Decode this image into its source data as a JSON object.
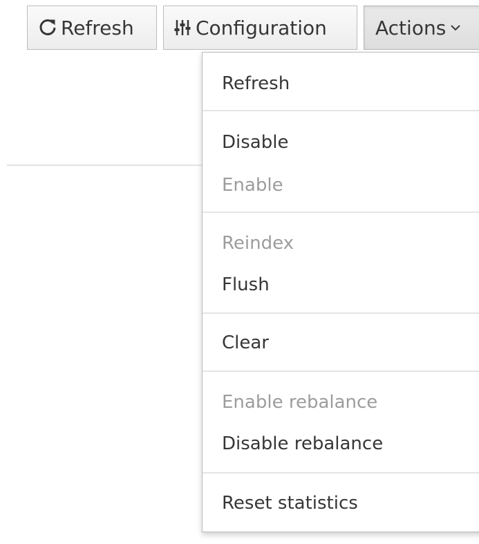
{
  "toolbar": {
    "refresh_label": "Refresh",
    "configuration_label": "Configuration",
    "actions_label": "Actions"
  },
  "actions_menu": {
    "items": [
      {
        "label": "Refresh",
        "enabled": true
      },
      {
        "label": "Disable",
        "enabled": true
      },
      {
        "label": "Enable",
        "enabled": false
      },
      {
        "label": "Reindex",
        "enabled": false
      },
      {
        "label": "Flush",
        "enabled": true
      },
      {
        "label": "Clear",
        "enabled": true
      },
      {
        "label": "Enable rebalance",
        "enabled": false
      },
      {
        "label": "Disable rebalance",
        "enabled": true
      },
      {
        "label": "Reset statistics",
        "enabled": true
      }
    ]
  },
  "icons": {
    "refresh": "refresh-icon",
    "configuration": "sliders-icon",
    "actions_caret": "chevron-down-icon"
  },
  "colors": {
    "text": "#363636",
    "disabled_text": "#9c9c9c",
    "border": "#bbbbbb"
  }
}
